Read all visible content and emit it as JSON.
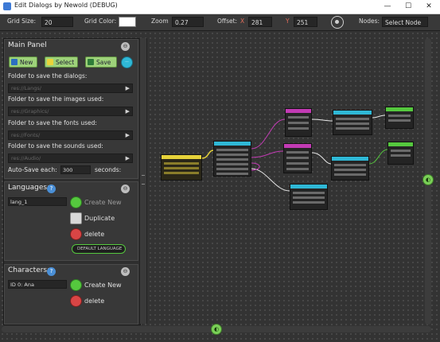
{
  "window": {
    "title": "Edit Dialogs by Newold (DEBUG)",
    "minimize": "—",
    "maximize": "☐",
    "close": "✕"
  },
  "toolbar": {
    "grid_size_label": "Grid Size:",
    "grid_size_value": "20",
    "grid_color_label": "Grid Color:",
    "grid_color_value": "#ffffff",
    "zoom_label": "Zoom",
    "zoom_value": "0.27",
    "offset_label": "Offset:",
    "offset_x_label": "X",
    "offset_x_value": "281",
    "offset_y_label": "Y",
    "offset_y_value": "251",
    "nodes_label": "Nodes:",
    "nodes_select": "Select Node",
    "nodes_select_arrow": "⬦"
  },
  "main_panel": {
    "title": "Main Panel",
    "collapse_icon": "⊖",
    "new_label": "New",
    "select_label": "Select",
    "save_label": "Save",
    "save_extra_badge": "···",
    "dialogs_label": "Folder to save the dialogs:",
    "dialogs_path": "res://Langs/",
    "images_label": "Folder to save the images used:",
    "images_path": "res://Graphics/",
    "fonts_label": "Folder to save the fonts used:",
    "fonts_path": "res://Fonts/",
    "sounds_label": "Folder to save the sounds used:",
    "sounds_path": "res://Audio/",
    "autosave_label": "Auto-Save each:",
    "autosave_value": "300",
    "autosave_unit": "seconds:",
    "path_arrow": "▶"
  },
  "languages": {
    "title": "Languages:",
    "help_icon": "?",
    "collapse_icon": "⊖",
    "current": "lang_1",
    "create_label": "Create New",
    "duplicate_label": "Duplicate",
    "delete_label": "delete",
    "default_label": "DEFAULT LANGUAGE"
  },
  "characters": {
    "title": "Characters:",
    "help_icon": "?",
    "collapse_icon": "⊖",
    "current": "ID 0: Ana",
    "create_label": "Create New",
    "delete_label": "delete"
  },
  "scroll": {
    "v_handle_icon": "◐",
    "h_handle_icon": "◐"
  },
  "colors": {
    "accent_green": "#7ad057",
    "node_yellow": "#e6d23a",
    "node_cyan": "#2fb8d6",
    "node_magenta": "#c23bb4",
    "node_green": "#55c83e"
  }
}
